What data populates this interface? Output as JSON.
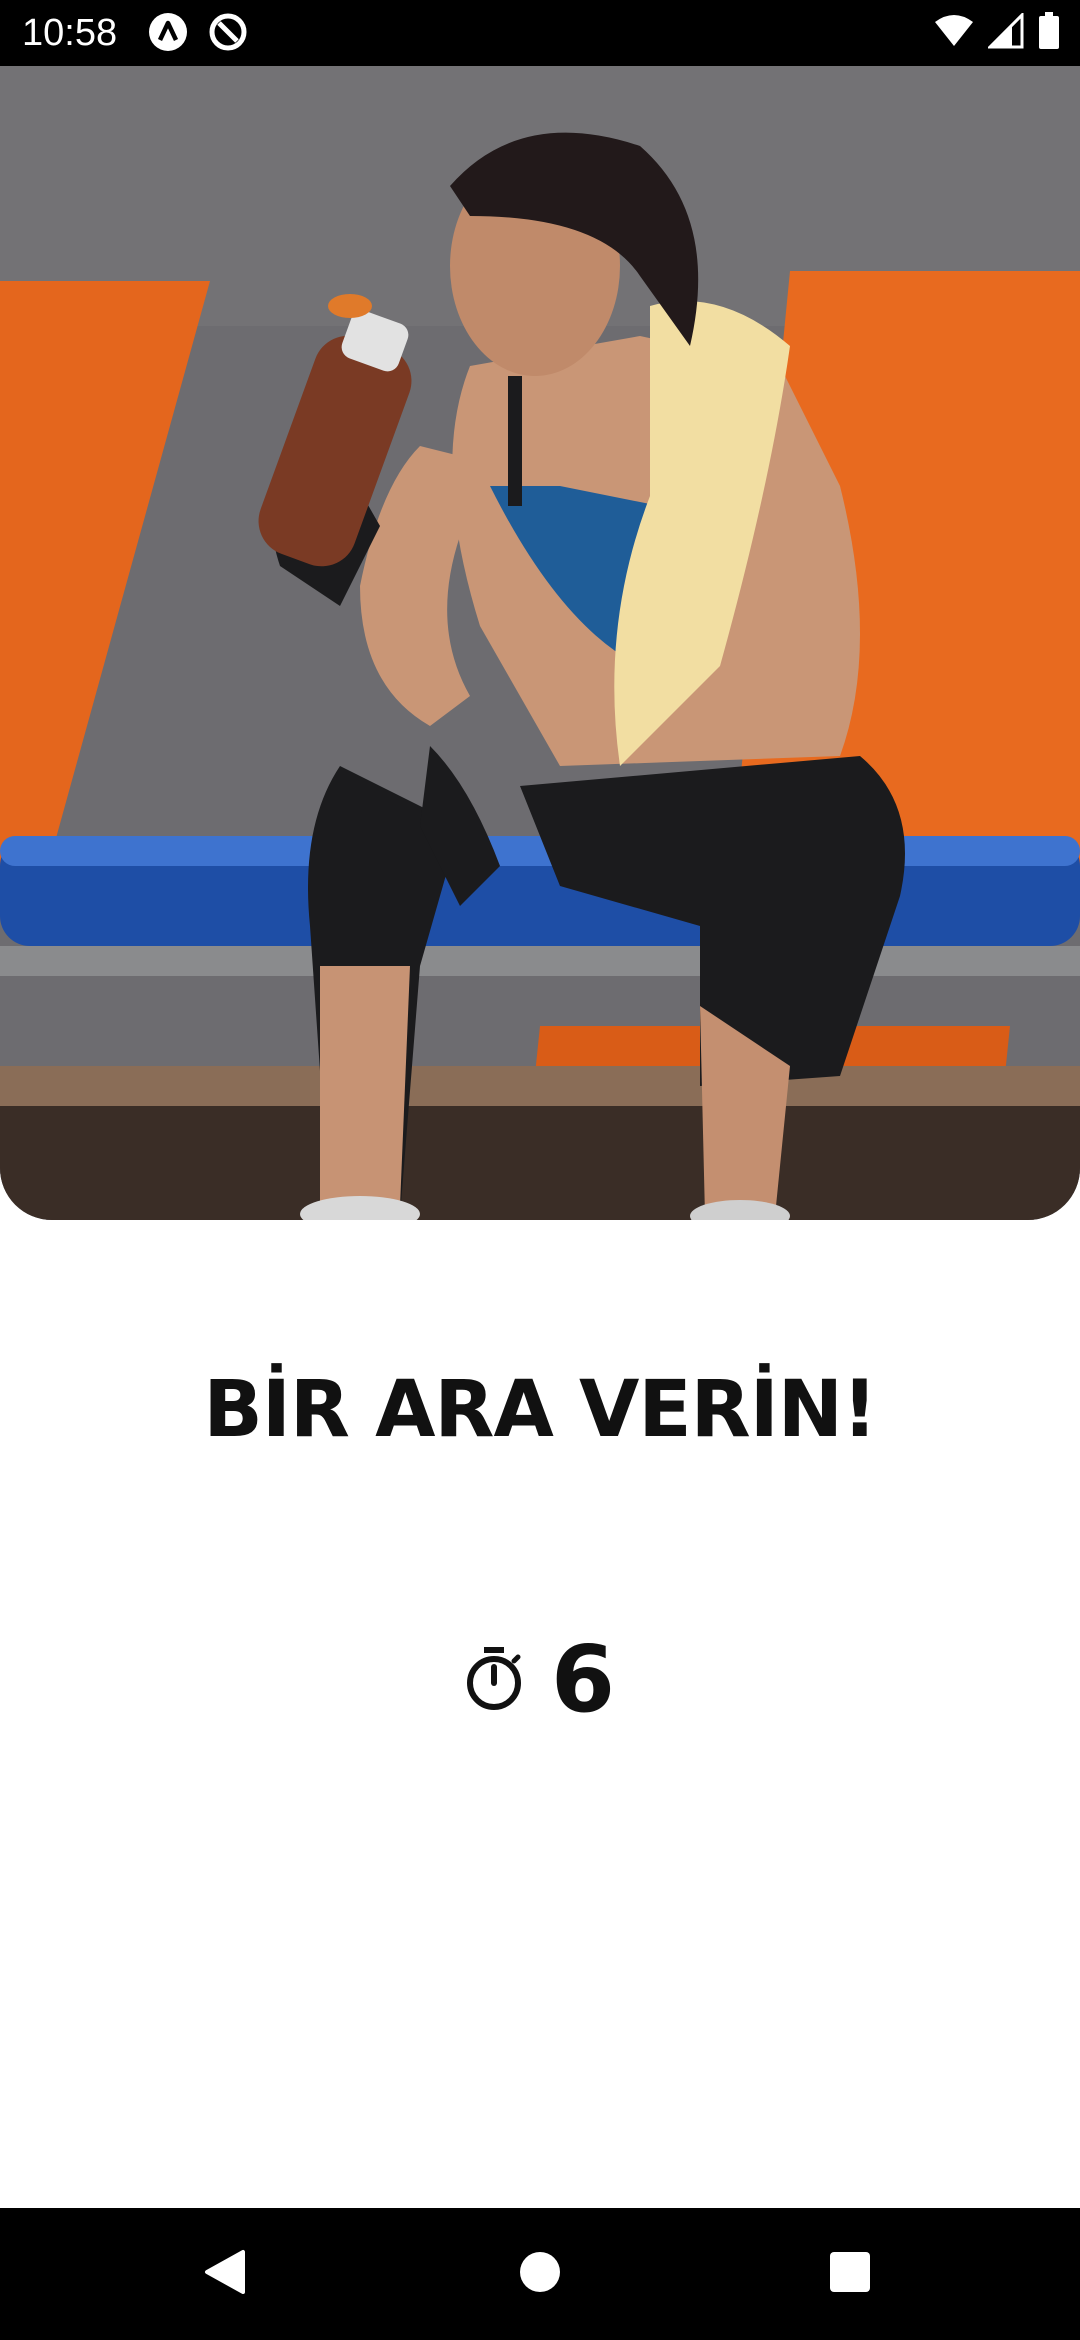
{
  "status_bar": {
    "time": "10:58",
    "left_icons": [
      "app-a-icon",
      "no-disturb-icon"
    ],
    "right_icons": [
      "wifi-icon",
      "cell-signal-icon",
      "battery-icon"
    ]
  },
  "hero": {
    "description_icon": "woman-drinking-water-photo"
  },
  "content": {
    "title": "BİR ARA VERİN!",
    "timer_icon": "stopwatch-icon",
    "timer_value": "6"
  },
  "nav_bar": {
    "buttons": [
      "back-icon",
      "home-icon",
      "recents-icon"
    ]
  },
  "colors": {
    "background": "#ffffff",
    "bars": "#000000",
    "text": "#111111",
    "accent_orange": "#e8661c",
    "bench_blue": "#1f4fa8"
  }
}
